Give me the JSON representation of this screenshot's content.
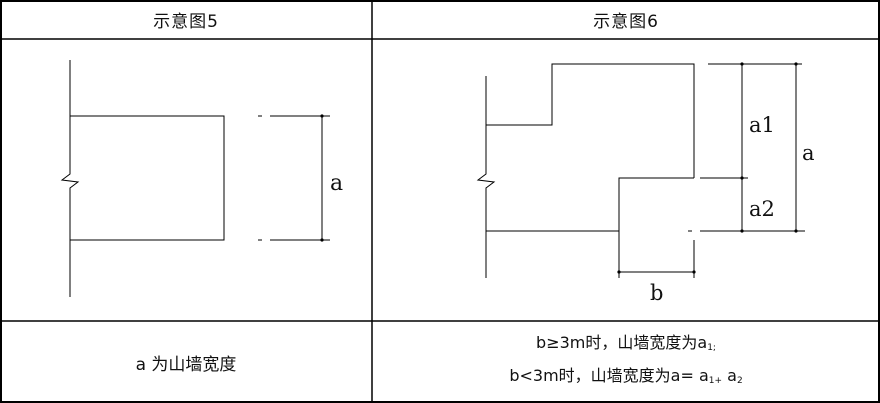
{
  "table": {
    "header_left": "示意图5",
    "header_right": "示意图6",
    "note_left": "a 为山墙宽度",
    "note_right_line1": {
      "prefix": "b≥3m时，山墙宽度为a",
      "sub": "1;"
    },
    "note_right_line2": {
      "prefix": "b<3m时，山墙宽度为a= a",
      "sub1": "1+",
      "mid": " a",
      "sub2": "2"
    }
  },
  "diagram5": {
    "label_a": "a"
  },
  "diagram6": {
    "label_a1": "a1",
    "label_a2": "a2",
    "label_a": "a",
    "label_b": "b"
  }
}
